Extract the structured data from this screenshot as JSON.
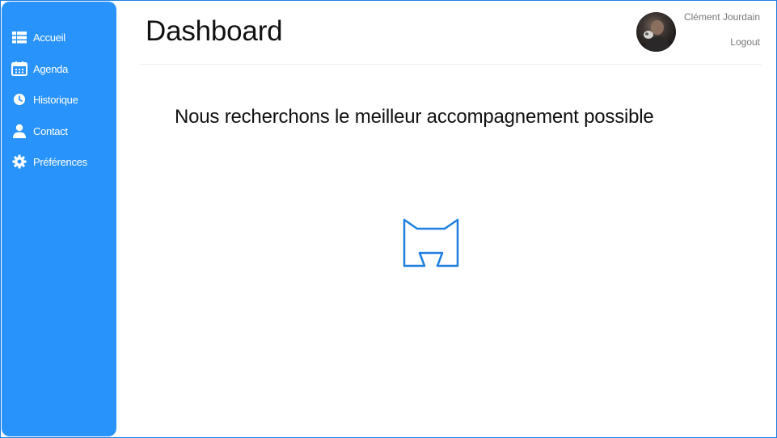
{
  "sidebar": {
    "items": [
      {
        "label": "Accueil",
        "icon": "dashboard-icon"
      },
      {
        "label": "Agenda",
        "icon": "calendar-icon"
      },
      {
        "label": "Historique",
        "icon": "clock-icon"
      },
      {
        "label": "Contact",
        "icon": "person-icon"
      },
      {
        "label": "Préférences",
        "icon": "gear-icon"
      }
    ]
  },
  "header": {
    "title": "Dashboard",
    "user_name": "Clément Jourdain",
    "logout_label": "Logout"
  },
  "main": {
    "message": "Nous recherchons le meilleur accompagnement possible",
    "logo_icon": "m-logo-icon"
  },
  "colors": {
    "sidebar": "#2893fb",
    "accent": "#1e7fe0",
    "text": "#111111",
    "muted": "#777777"
  }
}
